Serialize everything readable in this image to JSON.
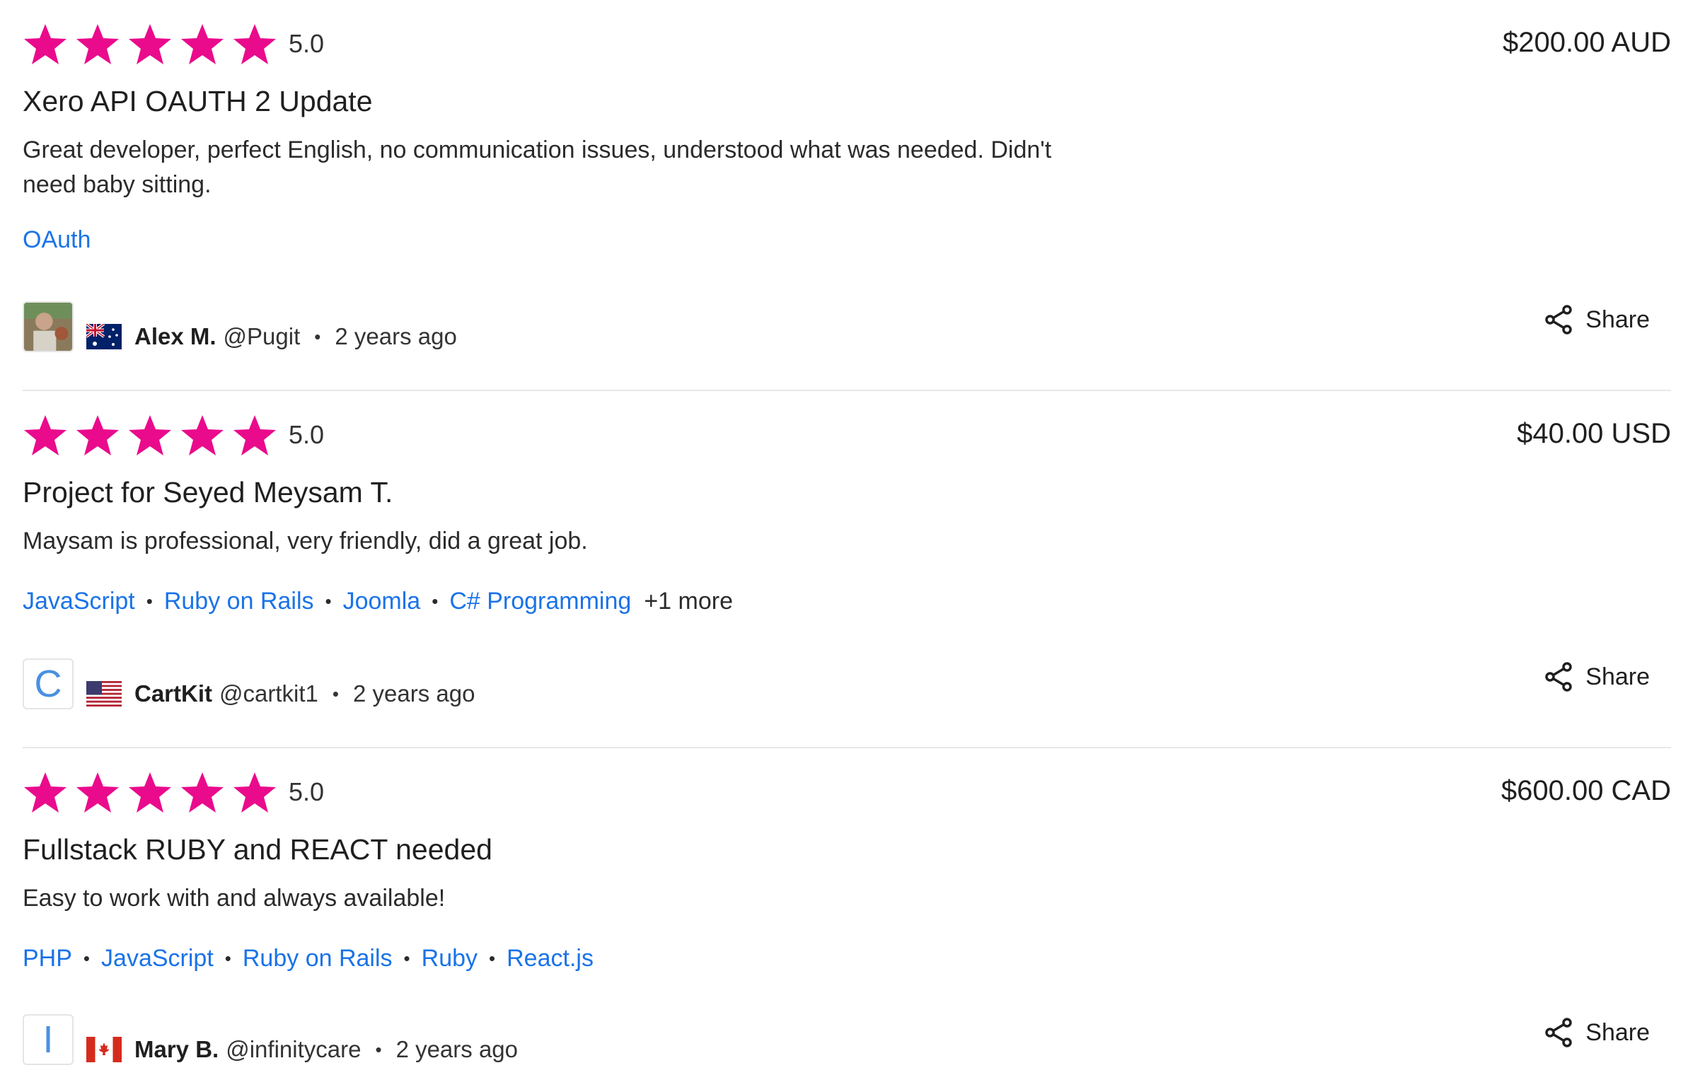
{
  "colors": {
    "star": "#ea0a8c",
    "link": "#1a73e8"
  },
  "reviews": [
    {
      "rating": "5.0",
      "price": "$200.00 AUD",
      "title": "Xero API OAUTH 2 Update",
      "description": "Great developer, perfect English, no communication issues, understood what was needed. Didn't need baby sitting.",
      "tags": [
        "OAuth"
      ],
      "more": "",
      "author": {
        "name": "Alex M.",
        "handle": "@Pugit",
        "country": "Australia",
        "avatar": "photo"
      },
      "time": "2 years ago",
      "share_label": "Share"
    },
    {
      "rating": "5.0",
      "price": "$40.00 USD",
      "title": "Project for Seyed Meysam T.",
      "description": "Maysam is professional, very friendly, did a great job.",
      "tags": [
        "JavaScript",
        "Ruby on Rails",
        "Joomla",
        "C# Programming"
      ],
      "more": "+1 more",
      "author": {
        "name": "CartKit",
        "handle": "@cartkit1",
        "country": "United States",
        "avatar": "C"
      },
      "time": "2 years ago",
      "share_label": "Share"
    },
    {
      "rating": "5.0",
      "price": "$600.00 CAD",
      "title": "Fullstack RUBY and REACT needed",
      "description": "Easy to work with and always available!",
      "tags": [
        "PHP",
        "JavaScript",
        "Ruby on Rails",
        "Ruby",
        "React.js"
      ],
      "more": "",
      "author": {
        "name": "Mary B.",
        "handle": "@infinitycare",
        "country": "Canada",
        "avatar": "I"
      },
      "time": "2 years ago",
      "share_label": "Share"
    }
  ]
}
